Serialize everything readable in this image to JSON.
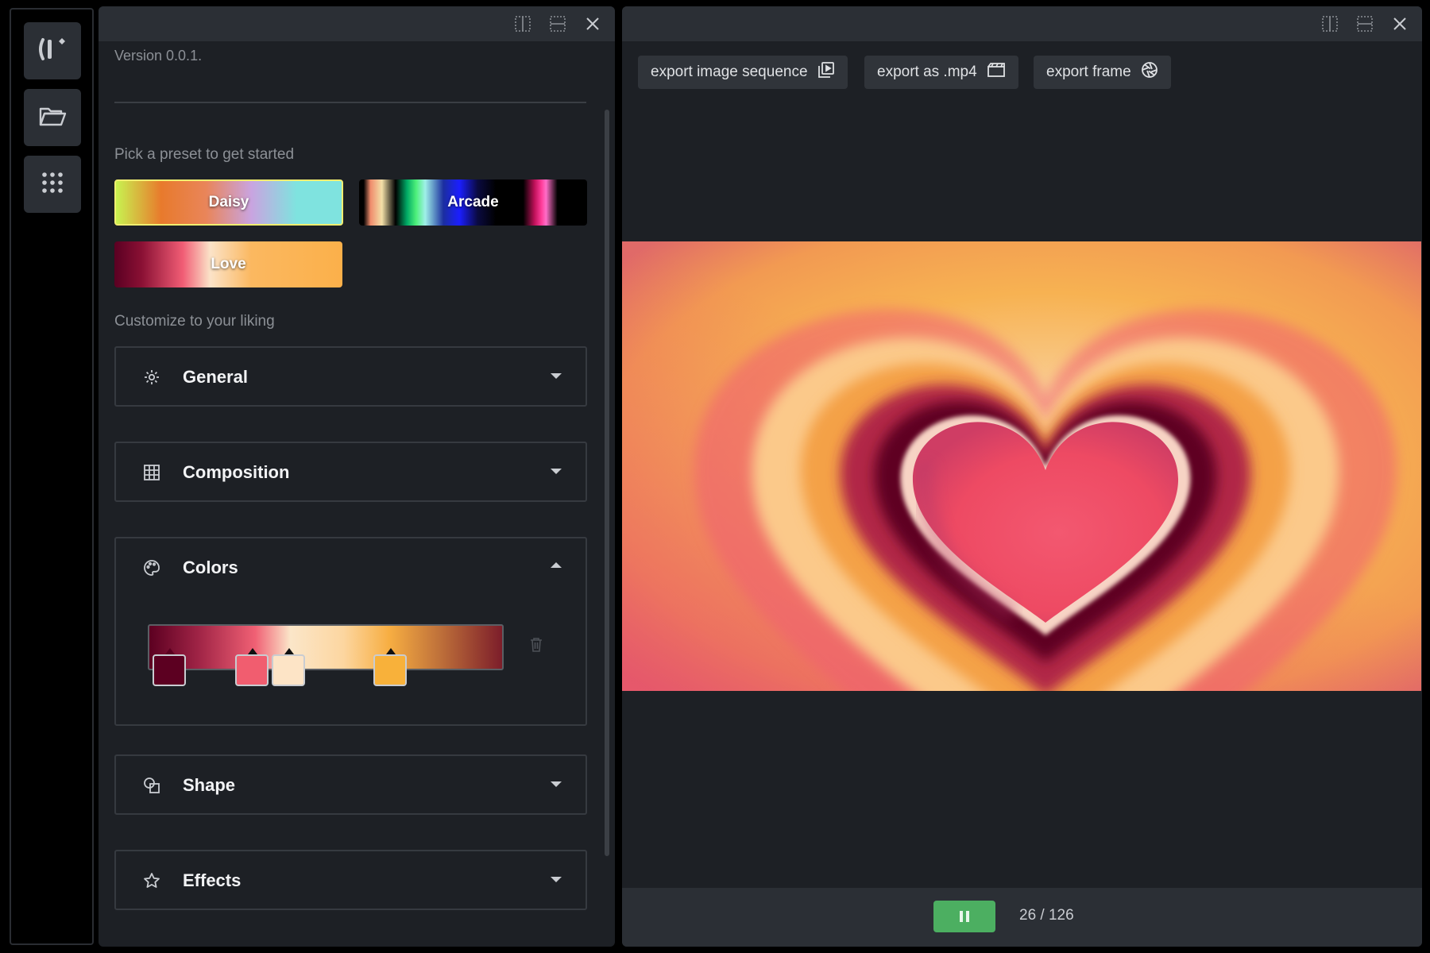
{
  "app": {
    "version": "Version 0.0.1."
  },
  "rail": {
    "items": [
      {
        "icon": "logo-icon"
      },
      {
        "icon": "folder-icon"
      },
      {
        "icon": "grid-icon"
      }
    ]
  },
  "left_panel": {
    "presets_label": "Pick a preset to get started",
    "presets": [
      {
        "label": "Daisy"
      },
      {
        "label": "Arcade"
      },
      {
        "label": "Love"
      }
    ],
    "customize_label": "Customize to your liking",
    "sections": [
      {
        "title": "General",
        "icon": "gear-icon",
        "expanded": false
      },
      {
        "title": "Composition",
        "icon": "grid-icon",
        "expanded": false
      },
      {
        "title": "Colors",
        "icon": "palette-icon",
        "expanded": true
      },
      {
        "title": "Shape",
        "icon": "shapes-icon",
        "expanded": false
      },
      {
        "title": "Effects",
        "icon": "star-icon",
        "expanded": false
      }
    ],
    "gradient_stops": [
      {
        "color": "#5c0021"
      },
      {
        "color": "#f15d6f"
      },
      {
        "color": "#fde4c6"
      },
      {
        "color": "#f8b13a"
      }
    ]
  },
  "right_panel": {
    "export_buttons": [
      {
        "label": "export image sequence",
        "icon": "image-sequence-icon"
      },
      {
        "label": "export as .mp4",
        "icon": "film-icon"
      },
      {
        "label": "export frame",
        "icon": "aperture-icon"
      }
    ],
    "playback": {
      "state": "playing",
      "frame_counter": "26 / 126",
      "current_frame": 26,
      "total_frames": 126
    }
  },
  "colors": {
    "accent_play": "#4caf61",
    "panel_bg": "#1d2025",
    "header_bg": "#2b2f35"
  }
}
